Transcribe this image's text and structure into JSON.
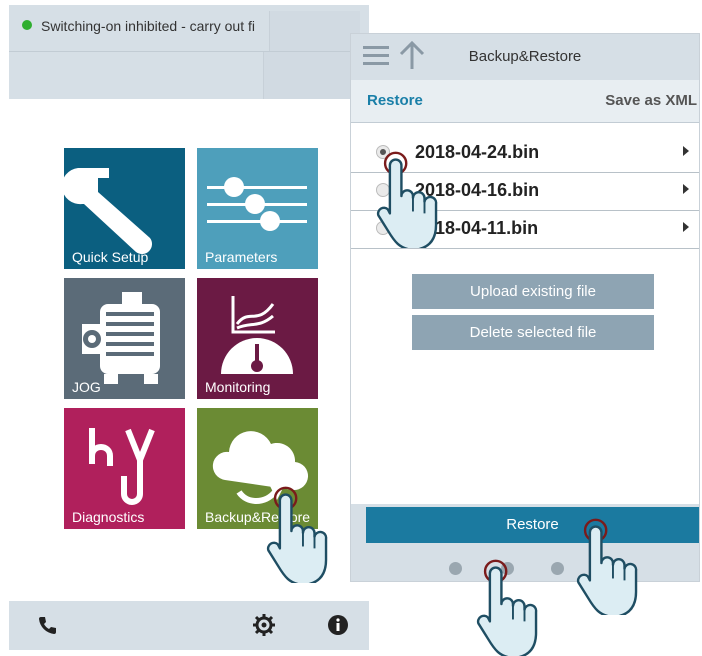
{
  "left_panel": {
    "status_text": "Switching-on inhibited - carry out fi",
    "tiles": [
      {
        "label": "Quick Setup",
        "icon": "wrench-icon"
      },
      {
        "label": "Parameters",
        "icon": "sliders-icon"
      },
      {
        "label": "JOG",
        "icon": "motor-icon"
      },
      {
        "label": "Monitoring",
        "icon": "gauge-icon"
      },
      {
        "label": "Diagnostics",
        "icon": "stethoscope-icon"
      },
      {
        "label": "Backup&Restore",
        "icon": "cloud-icon"
      }
    ],
    "bottom_icons": [
      "phone-icon",
      "gear-icon",
      "info-icon"
    ]
  },
  "right_panel": {
    "title": "Backup&Restore",
    "tabs": {
      "restore": "Restore",
      "save_xml": "Save as XML"
    },
    "files": [
      {
        "name": "2018-04-24.bin",
        "selected": true
      },
      {
        "name": "2018-04-16.bin",
        "selected": false
      },
      {
        "name": "2018-04-11.bin",
        "selected": false
      }
    ],
    "upload_label": "Upload existing file",
    "delete_label": "Delete selected file",
    "restore_button": "Restore"
  },
  "colors": {
    "quick_setup": "#0b5f80",
    "parameters": "#4e9fbb",
    "jog": "#5b6b78",
    "monitoring": "#6b1a44",
    "diagnostics": "#b0205c",
    "backup_restore": "#6b8b34",
    "accent": "#1b7aa0",
    "status_ok": "#2fae2f"
  }
}
